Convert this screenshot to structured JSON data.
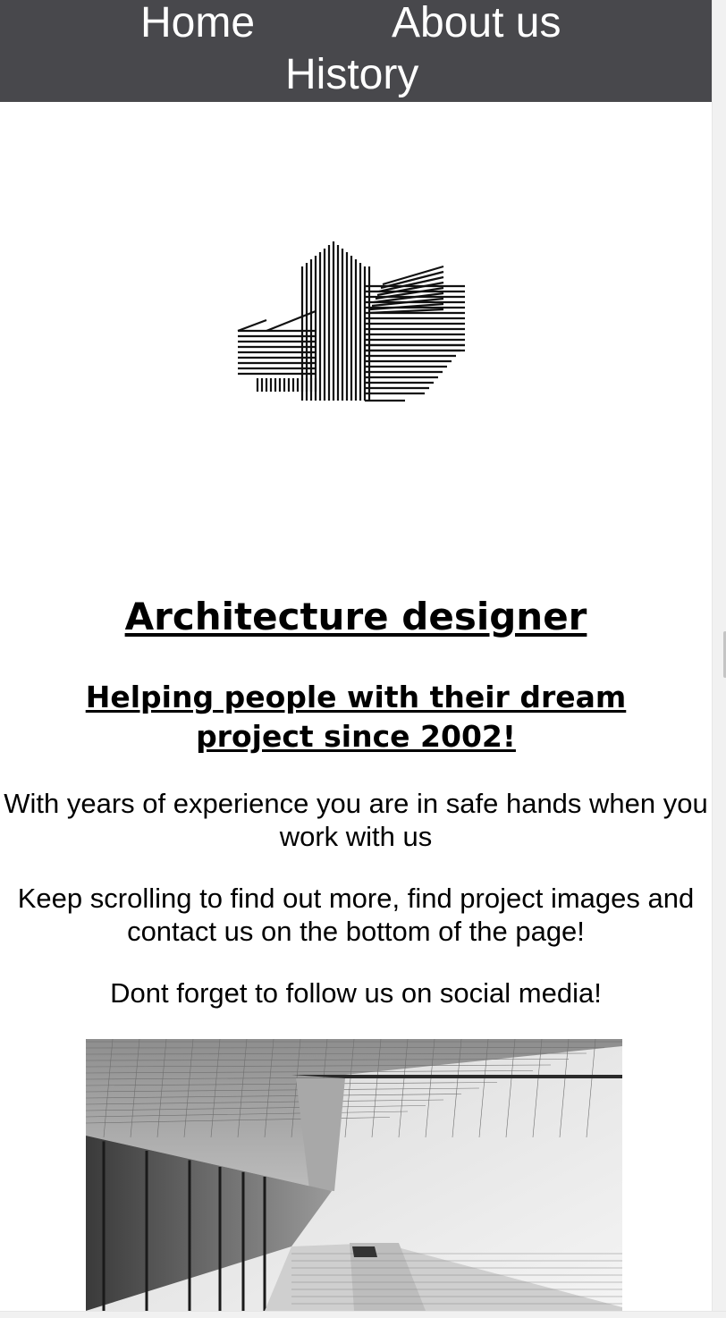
{
  "nav": {
    "items": [
      {
        "label": "Home"
      },
      {
        "label": "About us"
      },
      {
        "label": "History"
      }
    ]
  },
  "logo": {
    "icon": "building-logo-icon"
  },
  "hero": {
    "title": "Architecture designer",
    "subtitle": "Helping people with their dream project since 2002!",
    "paragraphs": [
      "With years of experience you are in safe hands when you work with us",
      "Keep scrolling to find out more, find project images and contact us on the bottom of the page!",
      "Dont forget to follow us on social media!"
    ]
  },
  "photo": {
    "icon": "building-photo"
  },
  "colors": {
    "nav_background": "#48484c",
    "nav_text": "#ffffff",
    "text": "#000000"
  }
}
